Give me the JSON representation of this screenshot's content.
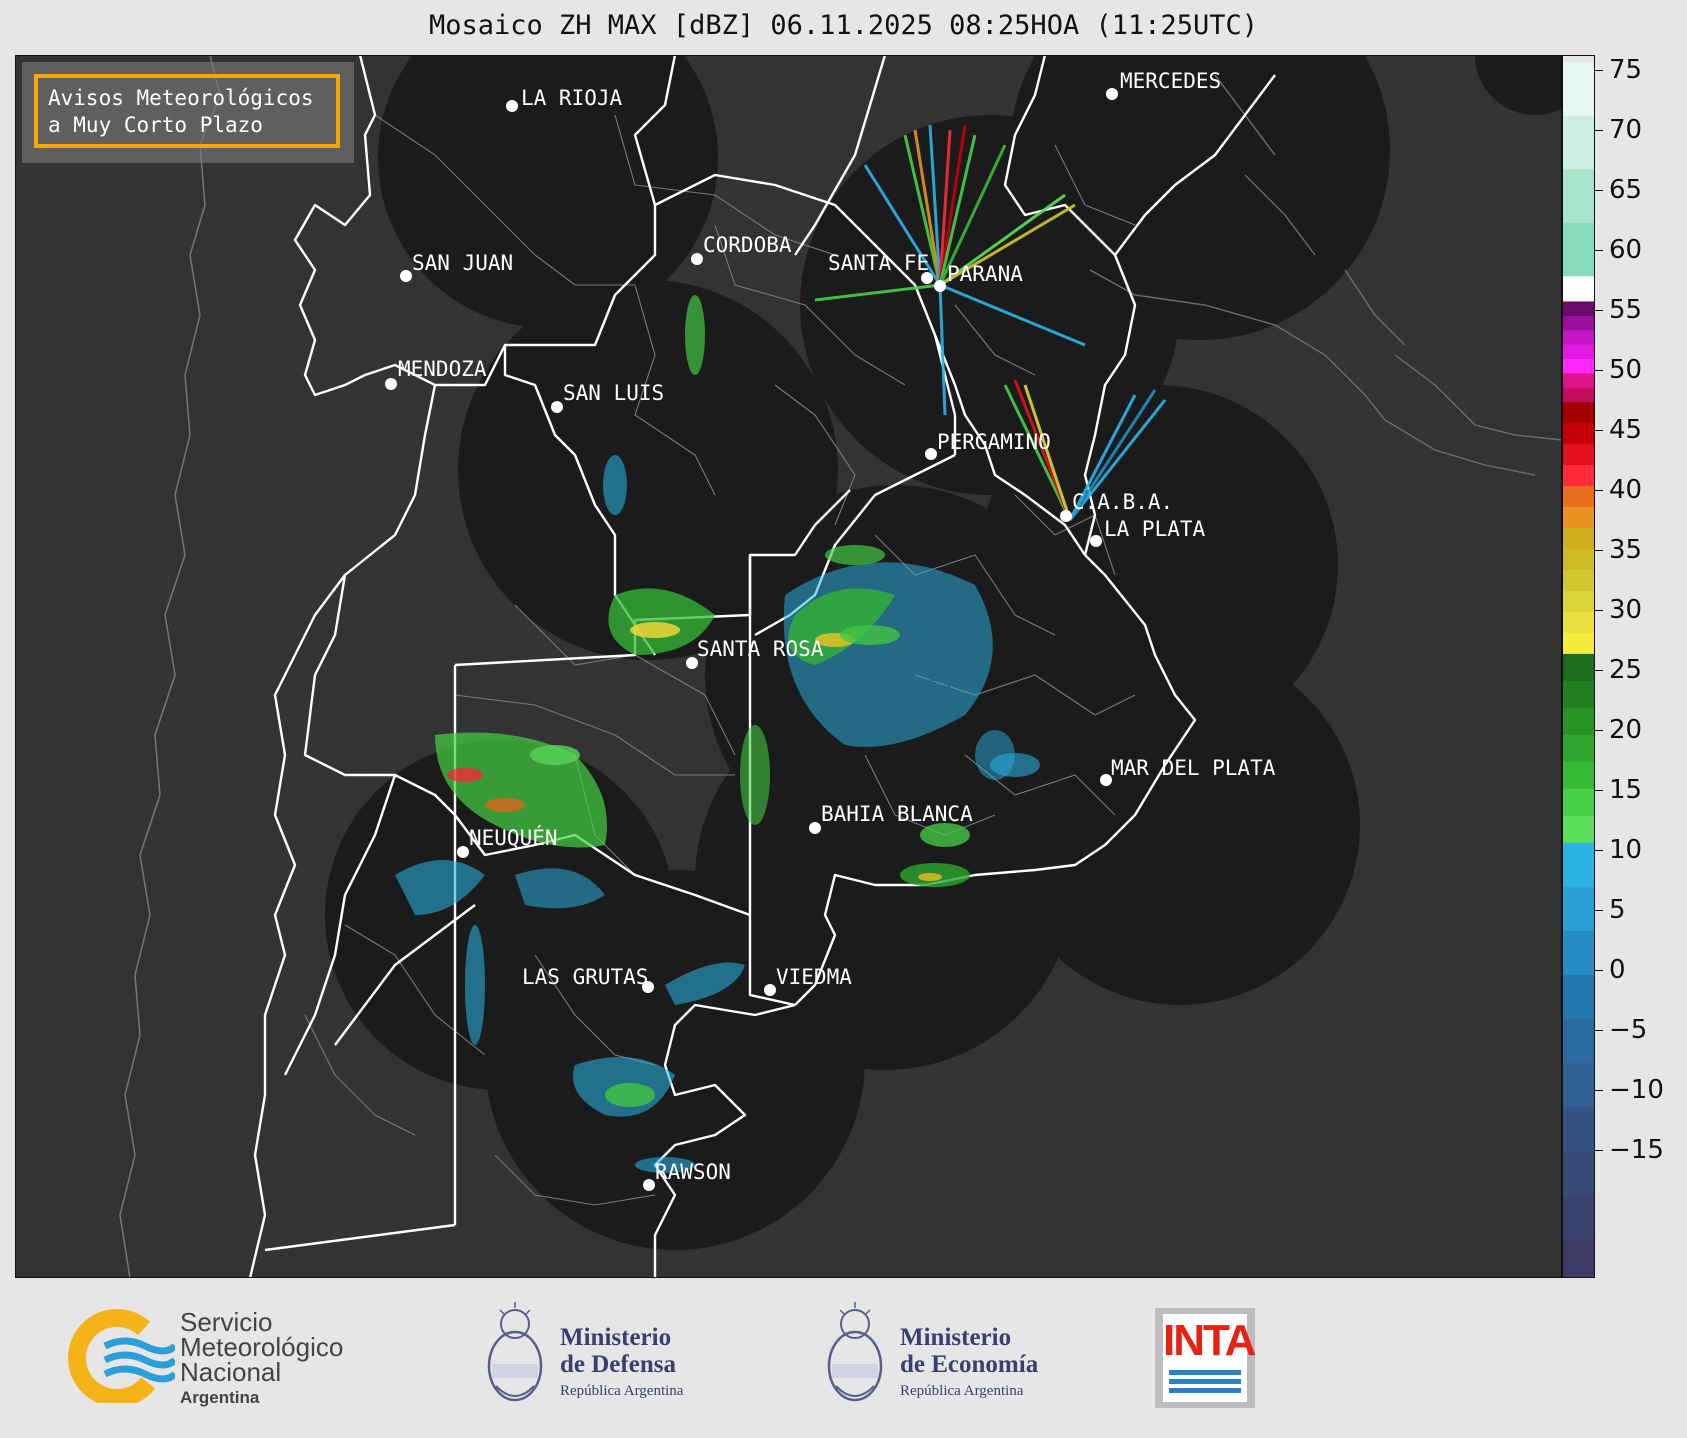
{
  "title": "Mosaico ZH MAX [dBZ] 06.11.2025 08:25HOA (11:25UTC)",
  "notice": "Avisos Meteorológicos\na Muy Corto Plazo",
  "colorbar": {
    "ticks": [
      "75",
      "70",
      "65",
      "60",
      "55",
      "50",
      "45",
      "40",
      "35",
      "30",
      "25",
      "20",
      "15",
      "10",
      "5",
      "0",
      "−5",
      "−10",
      "−15"
    ],
    "ramp": [
      {
        "from": 60,
        "to": 77,
        "colors": [
          "#e8f7ef",
          "#cdeee0",
          "#a8e4cc",
          "#86dbbb"
        ]
      },
      {
        "from": 58,
        "to": 60,
        "colors": [
          "#ffffff"
        ]
      },
      {
        "from": 50,
        "to": 58,
        "colors": [
          "#6b0a6b",
          "#9b0f9b",
          "#c416c4",
          "#e01adf",
          "#ff29ff",
          "#e0128a",
          "#c40d5c"
        ]
      },
      {
        "from": 40,
        "to": 50,
        "colors": [
          "#a30000",
          "#c60008",
          "#e31020",
          "#ff2a3a",
          "#e86c1c",
          "#e79223"
        ]
      },
      {
        "from": 30,
        "to": 40,
        "colors": [
          "#cfae1e",
          "#cdbb24",
          "#d2c72c",
          "#dcd53a",
          "#ece040",
          "#f5ec3d"
        ]
      },
      {
        "from": 15,
        "to": 30,
        "colors": [
          "#1d6b1d",
          "#217f21",
          "#279327",
          "#2ea72e",
          "#37bb37",
          "#46d046",
          "#5be05b"
        ]
      },
      {
        "from": -20,
        "to": 15,
        "colors": [
          "#2cb3e6",
          "#29a0d6",
          "#268cc4",
          "#2378b2",
          "#2b6aa0",
          "#305f91",
          "#345383",
          "#384a77",
          "#3b426d",
          "#3e3c64"
        ]
      }
    ]
  },
  "cities": [
    {
      "name": "LA RIOJA"
    },
    {
      "name": "MERCEDES"
    },
    {
      "name": "CORDOBA"
    },
    {
      "name": "SAN JUAN"
    },
    {
      "name": "SANTA FE"
    },
    {
      "name": "PARANA"
    },
    {
      "name": "MENDOZA"
    },
    {
      "name": "SAN LUIS"
    },
    {
      "name": "PERGAMINO"
    },
    {
      "name": "C.A.B.A."
    },
    {
      "name": "LA PLATA"
    },
    {
      "name": "SANTA ROSA"
    },
    {
      "name": "MAR DEL PLATA"
    },
    {
      "name": "BAHIA BLANCA"
    },
    {
      "name": "NEUQUÉN"
    },
    {
      "name": "LAS GRUTAS"
    },
    {
      "name": "VIEDMA"
    },
    {
      "name": "RAWSON"
    }
  ],
  "footer": {
    "smn": {
      "line1": "Servicio",
      "line2": "Meteorológico",
      "line3": "Nacional",
      "sub": "Argentina"
    },
    "defensa": {
      "line1": "Ministerio",
      "line2": "de Defensa",
      "sub": "República Argentina"
    },
    "economia": {
      "line1": "Ministerio",
      "line2": "de Economía",
      "sub": "República Argentina"
    },
    "inta": {
      "label": "INTA"
    }
  },
  "colors": {
    "radar_disc": "#1b1b1b",
    "background_map": "#333333",
    "boundary": "#ffffff",
    "accent_notice": "#f7a800"
  }
}
